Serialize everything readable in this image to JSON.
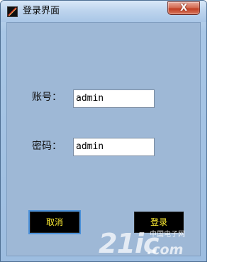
{
  "window": {
    "title": "登录界面",
    "app_icon": "pen-icon",
    "close_icon": "close-icon",
    "close_glyph": "X"
  },
  "form": {
    "account_label": "账号：",
    "account_value": "admin",
    "password_label": "密码：",
    "password_value": "admin"
  },
  "buttons": {
    "cancel_label": "取消",
    "login_label": "登录"
  },
  "watermark": {
    "logo": "21ic",
    "chinese": "中国电子网",
    "domain": ".com"
  },
  "colors": {
    "client_background": "#9eb8d6",
    "button_background": "#000000",
    "button_text": "#ffee33",
    "focus_outline": "#4a90d9"
  }
}
